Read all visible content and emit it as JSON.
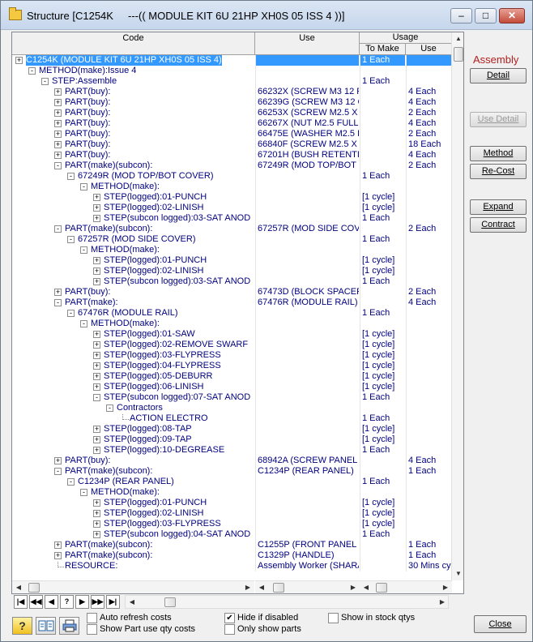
{
  "window": {
    "title": "Structure [C1254K     ---(( MODULE KIT 6U 21HP XH0S 05 ISS 4 ))]",
    "min": "–",
    "max": "□",
    "close": "✕"
  },
  "grid": {
    "headers": {
      "code": "Code",
      "use": "Use",
      "usage": "Usage",
      "to_make": "To Make",
      "use2": "Use"
    },
    "rows": [
      {
        "lvl": 0,
        "exp": "+",
        "code": "C1254K (MODULE KIT 6U 21HP XH0S 05 ISS 4)",
        "use": "",
        "to_make": "1 Each",
        "use2": "",
        "sel": true
      },
      {
        "lvl": 1,
        "exp": "-",
        "code": "METHOD(make):Issue 4",
        "use": "",
        "to_make": "",
        "use2": ""
      },
      {
        "lvl": 2,
        "exp": "-",
        "code": "STEP:Assemble",
        "use": "",
        "to_make": "1 Each",
        "use2": ""
      },
      {
        "lvl": 3,
        "exp": "+",
        "code": "PART(buy):",
        "use": "66232X (SCREW M3 12 P",
        "to_make": "",
        "use2": "4 Each"
      },
      {
        "lvl": 3,
        "exp": "+",
        "code": "PART(buy):",
        "use": "66239G (SCREW M3 12 C",
        "to_make": "",
        "use2": "4 Each"
      },
      {
        "lvl": 3,
        "exp": "+",
        "code": "PART(buy):",
        "use": "66253X (SCREW M2.5 X 1",
        "to_make": "",
        "use2": "2 Each"
      },
      {
        "lvl": 3,
        "exp": "+",
        "code": "PART(buy):",
        "use": "66267X (NUT M2.5 FULL",
        "to_make": "",
        "use2": "4 Each"
      },
      {
        "lvl": 3,
        "exp": "+",
        "code": "PART(buy):",
        "use": "66475E (WASHER M2.5 F",
        "to_make": "",
        "use2": "2 Each"
      },
      {
        "lvl": 3,
        "exp": "+",
        "code": "PART(buy):",
        "use": "66840F (SCREW M2.5 X 6",
        "to_make": "",
        "use2": "18 Each"
      },
      {
        "lvl": 3,
        "exp": "+",
        "code": "PART(buy):",
        "use": "67201H (BUSH RETENTI",
        "to_make": "",
        "use2": "4 Each"
      },
      {
        "lvl": 3,
        "exp": "-",
        "code": "PART(make)(subcon):",
        "use": "67249R (MOD TOP/BOT C",
        "to_make": "",
        "use2": "2 Each"
      },
      {
        "lvl": 4,
        "exp": "-",
        "code": "67249R (MOD TOP/BOT COVER)",
        "use": "",
        "to_make": "1 Each",
        "use2": ""
      },
      {
        "lvl": 5,
        "exp": "-",
        "code": "METHOD(make):",
        "use": "",
        "to_make": "",
        "use2": ""
      },
      {
        "lvl": 6,
        "exp": "+",
        "code": "STEP(logged):01-PUNCH",
        "use": "",
        "to_make": "[1 cycle]",
        "use2": ""
      },
      {
        "lvl": 6,
        "exp": "+",
        "code": "STEP(logged):02-LINISH",
        "use": "",
        "to_make": "[1 cycle]",
        "use2": ""
      },
      {
        "lvl": 6,
        "exp": "+",
        "code": "STEP(subcon logged):03-SAT ANOD",
        "use": "",
        "to_make": "1 Each",
        "use2": ""
      },
      {
        "lvl": 3,
        "exp": "-",
        "code": "PART(make)(subcon):",
        "use": "67257R (MOD SIDE COVE",
        "to_make": "",
        "use2": "2 Each"
      },
      {
        "lvl": 4,
        "exp": "-",
        "code": "67257R (MOD SIDE COVER)",
        "use": "",
        "to_make": "1 Each",
        "use2": ""
      },
      {
        "lvl": 5,
        "exp": "-",
        "code": "METHOD(make):",
        "use": "",
        "to_make": "",
        "use2": ""
      },
      {
        "lvl": 6,
        "exp": "+",
        "code": "STEP(logged):01-PUNCH",
        "use": "",
        "to_make": "[1 cycle]",
        "use2": ""
      },
      {
        "lvl": 6,
        "exp": "+",
        "code": "STEP(logged):02-LINISH",
        "use": "",
        "to_make": "[1 cycle]",
        "use2": ""
      },
      {
        "lvl": 6,
        "exp": "+",
        "code": "STEP(subcon logged):03-SAT ANOD",
        "use": "",
        "to_make": "1 Each",
        "use2": ""
      },
      {
        "lvl": 3,
        "exp": "+",
        "code": "PART(buy):",
        "use": "67473D (BLOCK SPACER",
        "to_make": "",
        "use2": "2 Each"
      },
      {
        "lvl": 3,
        "exp": "-",
        "code": "PART(make):",
        "use": "67476R (MODULE RAIL)",
        "to_make": "",
        "use2": "4 Each"
      },
      {
        "lvl": 4,
        "exp": "-",
        "code": "67476R (MODULE RAIL)",
        "use": "",
        "to_make": "1 Each",
        "use2": ""
      },
      {
        "lvl": 5,
        "exp": "-",
        "code": "METHOD(make):",
        "use": "",
        "to_make": "",
        "use2": ""
      },
      {
        "lvl": 6,
        "exp": "+",
        "code": "STEP(logged):01-SAW",
        "use": "",
        "to_make": "[1 cycle]",
        "use2": ""
      },
      {
        "lvl": 6,
        "exp": "+",
        "code": "STEP(logged):02-REMOVE SWARF",
        "use": "",
        "to_make": "[1 cycle]",
        "use2": ""
      },
      {
        "lvl": 6,
        "exp": "+",
        "code": "STEP(logged):03-FLYPRESS",
        "use": "",
        "to_make": "[1 cycle]",
        "use2": ""
      },
      {
        "lvl": 6,
        "exp": "+",
        "code": "STEP(logged):04-FLYPRESS",
        "use": "",
        "to_make": "[1 cycle]",
        "use2": ""
      },
      {
        "lvl": 6,
        "exp": "+",
        "code": "STEP(logged):05-DEBURR",
        "use": "",
        "to_make": "[1 cycle]",
        "use2": ""
      },
      {
        "lvl": 6,
        "exp": "+",
        "code": "STEP(logged):06-LINISH",
        "use": "",
        "to_make": "[1 cycle]",
        "use2": ""
      },
      {
        "lvl": 6,
        "exp": "-",
        "code": "STEP(subcon logged):07-SAT ANOD",
        "use": "",
        "to_make": "1 Each",
        "use2": ""
      },
      {
        "lvl": 7,
        "exp": "-",
        "code": "Contractors",
        "use": "",
        "to_make": "",
        "use2": ""
      },
      {
        "lvl": 8,
        "exp": "",
        "code": "ACTION ELECTRO",
        "use": "",
        "to_make": "1 Each",
        "use2": ""
      },
      {
        "lvl": 6,
        "exp": "+",
        "code": "STEP(logged):08-TAP",
        "use": "",
        "to_make": "[1 cycle]",
        "use2": ""
      },
      {
        "lvl": 6,
        "exp": "+",
        "code": "STEP(logged):09-TAP",
        "use": "",
        "to_make": "[1 cycle]",
        "use2": ""
      },
      {
        "lvl": 6,
        "exp": "+",
        "code": "STEP(logged):10-DEGREASE",
        "use": "",
        "to_make": "1 Each",
        "use2": ""
      },
      {
        "lvl": 3,
        "exp": "+",
        "code": "PART(buy):",
        "use": "68942A (SCREW PANEL I",
        "to_make": "",
        "use2": "4 Each"
      },
      {
        "lvl": 3,
        "exp": "-",
        "code": "PART(make)(subcon):",
        "use": "C1234P (REAR PANEL)",
        "to_make": "",
        "use2": "1 Each"
      },
      {
        "lvl": 4,
        "exp": "-",
        "code": "C1234P (REAR PANEL)",
        "use": "",
        "to_make": "1 Each",
        "use2": ""
      },
      {
        "lvl": 5,
        "exp": "-",
        "code": "METHOD(make):",
        "use": "",
        "to_make": "",
        "use2": ""
      },
      {
        "lvl": 6,
        "exp": "+",
        "code": "STEP(logged):01-PUNCH",
        "use": "",
        "to_make": "[1 cycle]",
        "use2": ""
      },
      {
        "lvl": 6,
        "exp": "+",
        "code": "STEP(logged):02-LINISH",
        "use": "",
        "to_make": "[1 cycle]",
        "use2": ""
      },
      {
        "lvl": 6,
        "exp": "+",
        "code": "STEP(logged):03-FLYPRESS",
        "use": "",
        "to_make": "[1 cycle]",
        "use2": ""
      },
      {
        "lvl": 6,
        "exp": "+",
        "code": "STEP(subcon logged):04-SAT ANOD",
        "use": "",
        "to_make": "1 Each",
        "use2": ""
      },
      {
        "lvl": 3,
        "exp": "+",
        "code": "PART(make)(subcon):",
        "use": "C1255P (FRONT PANEL M",
        "to_make": "",
        "use2": "1 Each"
      },
      {
        "lvl": 3,
        "exp": "+",
        "code": "PART(make)(subcon):",
        "use": "C1329P (HANDLE)",
        "to_make": "",
        "use2": "1 Each"
      },
      {
        "lvl": 3,
        "exp": "",
        "code": "RESOURCE:",
        "use": "Assembly Worker (SHARA",
        "to_make": "",
        "use2": "30 Mins cyc"
      }
    ]
  },
  "nav": [
    "|◀",
    "◀◀",
    "◀",
    "?",
    "▶",
    "▶▶",
    "▶|"
  ],
  "side": {
    "label": "Assembly",
    "detail": "Detail",
    "use_detail": "Use Detail",
    "method": "Method",
    "recost": "Re-Cost",
    "expand": "Expand",
    "contract": "Contract"
  },
  "bottom": {
    "auto_refresh": "Auto refresh costs",
    "show_part_use": "Show Part use qty costs",
    "hide_disabled": "Hide if disabled",
    "only_show_parts": "Only show parts",
    "show_in_stock": "Show in stock qtys",
    "close": "Close",
    "hide_disabled_checked": true
  }
}
